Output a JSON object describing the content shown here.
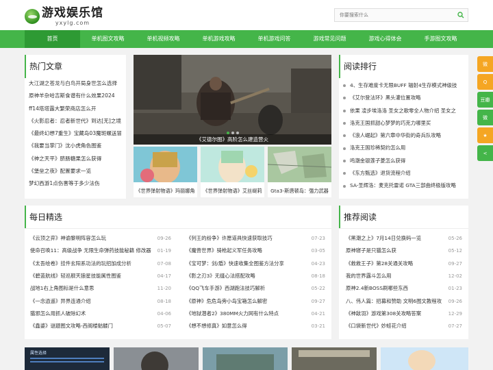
{
  "header": {
    "logo_title": "游戏娱乐馆",
    "logo_sub": "yxylg.com",
    "search_placeholder": "你要搜索什么"
  },
  "nav": [
    "首页",
    "单机图文攻略",
    "单机视频攻略",
    "单机游戏攻略",
    "单机游戏问答",
    "游戏常见问题",
    "游戏心得体会",
    "手游图文攻略"
  ],
  "hot": {
    "title": "热门文章",
    "items": [
      "大江湖之苍龙与白鸟开局身世怎么选择",
      "原神羊杂哈吉斯食谱有什么效果2024",
      "ff14塔塔露大繁荣商店怎么开",
      "《火影忍者：忍者新世代》到达[无]之境",
      "《最终幻想7重生》宝藏岛03魔斑螺送冒",
      "《我要当掌门》沈小虎角色图鉴",
      "《神之天平》脐肠糖果怎么获得",
      "《堡垒之夜》配置要求一览",
      "梦幻西游1点伤害等于多少法伤"
    ]
  },
  "slider": {
    "caption": "《艾德尔图》高阶怎么建造营火",
    "dots": 3
  },
  "thumbs": [
    "《世界弹射物语》玛丽娜角",
    "《世界弹射物语》艾丝缇莉",
    "Gta3-斯唐顿岛：强力武器"
  ],
  "ranking": {
    "title": "阅读排行",
    "items": [
      "4、生存难度卡无限BUFF 辐射4生存模式神级技",
      "《艾尔登法环》黑头灌位置攻略",
      "依果 凌步埃洛洛 圣女之歌零全人物介绍 圣女之",
      "洛克王国抓甜心梦梦的巧克力哪里买",
      "《浪人崛起》第六章中华街的奇兵队攻略",
      "洛克王国珍稀契约怎么用",
      "鸣潮金银莲子菱怎么获得",
      "《东方甄选》退货流程介绍",
      "SA-圣辉洛：麦克托雷诺 GTA三部曲终极版攻略"
    ]
  },
  "daily": {
    "title": "每日精选",
    "left": [
      {
        "t": "《云顶之弈》神谕黎明阵容怎么玩",
        "d": "09-26"
      },
      {
        "t": "使命召唤11：高级战争 无限生命弹药技能秘籍 修改器",
        "d": "01-19"
      },
      {
        "t": "《太吾绘卷》挂件玄阳系功法的玩招加成分析",
        "d": "07-08"
      },
      {
        "t": "《碧蓝航线》轻巡舰天狼星技能属性图鉴",
        "d": "04-17"
      },
      {
        "t": "战地1右上角图标是什么意思",
        "d": "11-20"
      },
      {
        "t": "《一念逍遥》异界连通介绍",
        "d": "08-18"
      },
      {
        "t": "猫邪怎么用抓人破除幻术",
        "d": "04-06"
      },
      {
        "t": "《鑫婆》谜题图文攻略-西阁楼骷髅门",
        "d": "05-07"
      }
    ],
    "right": [
      {
        "t": "《列王的纷争》许愿道具快速获取技巧",
        "d": "07-23"
      },
      {
        "t": "《魔兽世界》骑枪起义军任务攻略",
        "d": "03-05"
      },
      {
        "t": "《宝可梦：剑/盾》快速收集全图鉴方法分享",
        "d": "04-23"
      },
      {
        "t": "《影之刃3》无缝心法搭配攻略",
        "d": "08-18"
      },
      {
        "t": "《QQ飞车手游》西湖跑法技巧解析",
        "d": "05-22"
      },
      {
        "t": "《原神》危危岛旁小岛宝箱怎么解密",
        "d": "09-27"
      },
      {
        "t": "《地狱潜者2》380MM火力网有什么特点",
        "d": "04-21"
      },
      {
        "t": "《想不想修真》如意怎么得",
        "d": "03-21"
      }
    ]
  },
  "recommend": {
    "title": "推荐阅读",
    "items": [
      {
        "t": "《黑潮之上》7月14日兑换码一览",
        "d": "05-26"
      },
      {
        "t": "原神寝子是只猫怎么获",
        "d": "05-12"
      },
      {
        "t": "《救救王子》第28关通关攻略",
        "d": "09-27"
      },
      {
        "t": "我的世界露斗怎么用",
        "d": "12-02"
      },
      {
        "t": "原神2.4新BOSS刷哪些东西",
        "d": "01-23"
      },
      {
        "t": "八、伟人篇：招募和赞助 文明6图文教程攻略",
        "d": "09-26"
      },
      {
        "t": "《神敌羽》游戏第308关攻略答案",
        "d": "12-29"
      },
      {
        "t": "《口袋新世代》妙蛙花介绍",
        "d": "07-27"
      }
    ]
  },
  "gallery_text": [
    "属性选择"
  ],
  "colors": {
    "brand": "#44b549",
    "nav_active": "#2e9a34"
  },
  "share_icons": [
    "weibo-icon",
    "qzone-icon",
    "douban-icon",
    "wechat-icon",
    "favorite-icon",
    "share-icon"
  ],
  "share_labels": [
    "微",
    "Q",
    "豆瓣",
    "微",
    "★",
    "<"
  ]
}
